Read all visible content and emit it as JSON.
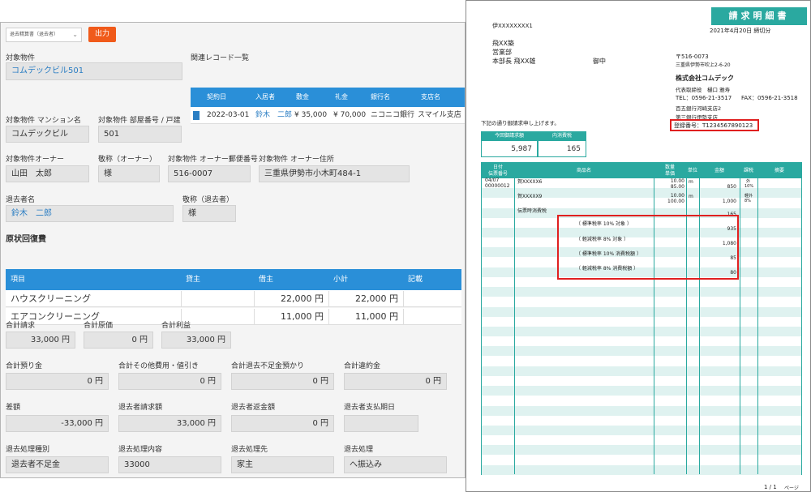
{
  "left_panel": {
    "select_value": "退去精算書（退去者）",
    "output_button": "出力",
    "property": {
      "label": "対象物件",
      "value": "コムデックビル501"
    },
    "related_records": {
      "title": "関連レコード一覧",
      "columns": [
        "契約日",
        "入居者",
        "敷金",
        "礼金",
        "銀行名",
        "支店名"
      ],
      "row": [
        "2022-03-01",
        "鈴木　二郎",
        "¥ 35,000",
        "¥ 70,000",
        "ニコニコ銀行",
        "スマイル支店"
      ]
    },
    "mansion_name": {
      "label": "対象物件 マンション名",
      "value": "コムデックビル"
    },
    "room_number": {
      "label": "対象物件 部屋番号 / 戸建",
      "value": "501"
    },
    "owner": {
      "label": "対象物件オーナー",
      "value": "山田　太郎"
    },
    "owner_honorific": {
      "label": "敬称（オーナー）",
      "value": "様"
    },
    "owner_postal": {
      "label": "対象物件 オーナー郵便番号",
      "value": "516-0007"
    },
    "owner_address": {
      "label": "対象物件 オーナー住所",
      "value": "三重県伊勢市小木町484-1"
    },
    "tenant": {
      "label": "退去者名",
      "value": "鈴木　二郎"
    },
    "tenant_honorific": {
      "label": "敬称（退去者）",
      "value": "様"
    },
    "restore_section": {
      "title": "原状回復費",
      "columns": [
        "項目",
        "貸主",
        "借主",
        "小計",
        "記載"
      ],
      "rows": [
        {
          "item": "ハウスクリーニング",
          "lessor": "",
          "lessee": "22,000 円",
          "subtotal": "22,000 円"
        },
        {
          "item": "エアコンクリーニング",
          "lessor": "",
          "lessee": "11,000 円",
          "subtotal": "11,000 円"
        }
      ]
    },
    "totals": [
      {
        "label": "合計請求",
        "value": "33,000 円"
      },
      {
        "label": "合計原価",
        "value": "0 円"
      },
      {
        "label": "合計利益",
        "value": "33,000 円"
      }
    ],
    "deposits": [
      {
        "label": "合計預り金",
        "value": "0 円"
      },
      {
        "label": "合計その他費用・値引き",
        "value": "0 円"
      },
      {
        "label": "合計退去不足金預かり",
        "value": "0 円"
      },
      {
        "label": "合計違約金",
        "value": "0 円"
      }
    ],
    "balance": [
      {
        "label": "差額",
        "value": "-33,000 円"
      },
      {
        "label": "退去者請求額",
        "value": "33,000 円"
      },
      {
        "label": "退去者返金額",
        "value": "0 円"
      },
      {
        "label": "退去者支払期日",
        "value": ""
      }
    ],
    "processing": [
      {
        "label": "退去処理種別",
        "value": "退去者不足金"
      },
      {
        "label": "退去処理内容",
        "value": "33000"
      },
      {
        "label": "退去処理先",
        "value": "家主"
      },
      {
        "label": "退去処理",
        "value": "へ振込み"
      }
    ]
  },
  "invoice": {
    "doc_number": "伊XXXXXXXX1",
    "title": "請求明細書",
    "date": "2021年4月20日 締切分",
    "recipient_lines": [
      "飛XX築",
      "営業部",
      "本部長 飛XX雄"
    ],
    "recipient_suffix": "御中",
    "sender_postal": "〒516-0073",
    "sender_address": "三重県伊勢市吹上2-6-20",
    "sender_company": "株式会社コムデック",
    "sender_rep": "代表取締役　樋口 雅寿",
    "sender_tel": "TEL：0596-21-3517",
    "sender_fax": "FAX：0596-21-3518",
    "bank_line1": "百五銀行河崎支店2",
    "bank_line2": "第三銀行伊勢支店",
    "registration": "登録番号：T1234567890123",
    "intro": "下記の通り御請求申し上げます。",
    "summary": [
      {
        "label": "今回御請求額",
        "value": "5,987"
      },
      {
        "label": "内消費税",
        "value": "165"
      }
    ],
    "columns": {
      "date_no": [
        "日付",
        "伝票番号"
      ],
      "product": "商品名",
      "qty_price": [
        "数量",
        "単価"
      ],
      "unit": "単位",
      "amount": "金額",
      "tax_type": "課税",
      "note": "摘要"
    },
    "rows": [
      {
        "date": "04/07",
        "slip": "00000012",
        "product": "賀XXXXX6",
        "qty": "10.00",
        "price": "85.00",
        "unit": "m",
        "amount": "850",
        "tax1": "外",
        "tax2": "10%"
      },
      {
        "product": "賀XXXXX9",
        "qty": "10.00",
        "price": "100.00",
        "unit": "m",
        "amount": "1,000",
        "tax1": "軽外",
        "tax2": "8%"
      },
      {
        "product": "伝票時消費税",
        "amount": "165"
      }
    ],
    "tax_breakdown": [
      {
        "label": "（ 標準税率 10% 対象 ）",
        "value": "935"
      },
      {
        "label": "（ 軽減税率 8% 対象 ）",
        "value": "1,080"
      },
      {
        "label": "（ 標準税率 10% 消費税額 ）",
        "value": "85"
      },
      {
        "label": "（ 軽減税率 8% 消費税額 ）",
        "value": "80"
      }
    ],
    "page": "1 / 1",
    "page_suffix": "ページ"
  },
  "colors": {
    "blue_header": "#2a8fd8",
    "orange_button": "#f05a1a",
    "teal": "#2aa9a0",
    "highlight_red": "#e02020"
  }
}
